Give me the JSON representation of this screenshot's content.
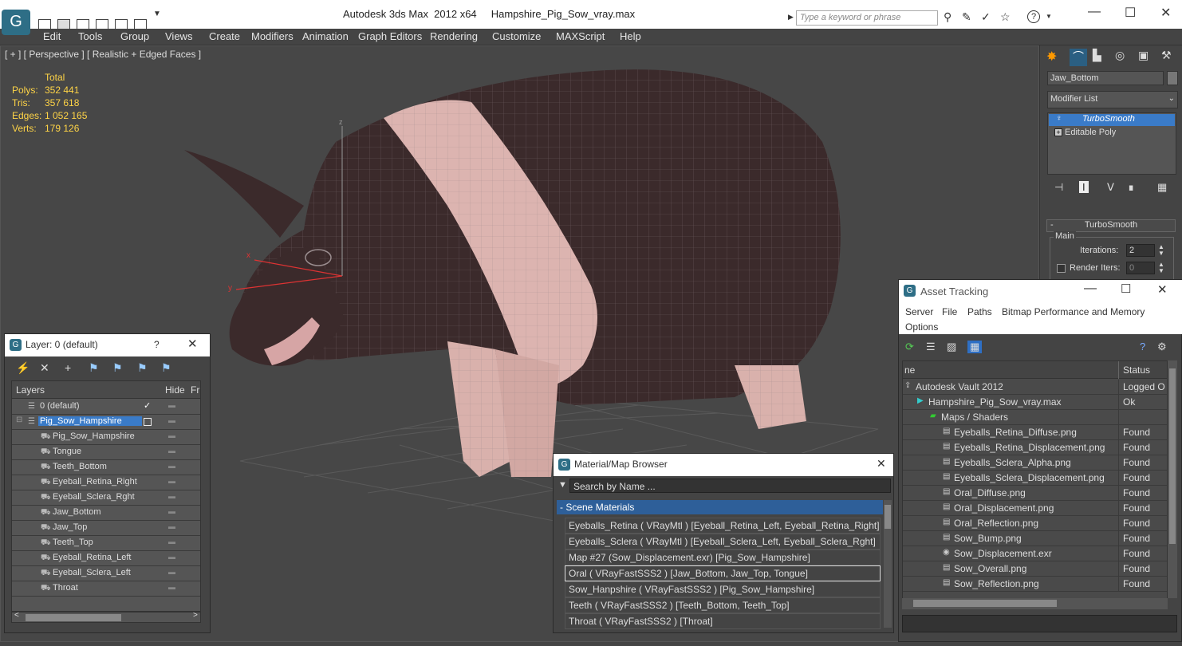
{
  "title": {
    "app": "Autodesk 3ds Max  2012 x64",
    "file": "Hampshire_Pig_Sow_vray.max"
  },
  "search": {
    "placeholder": "Type a keyword or phrase"
  },
  "menu": [
    "Edit",
    "Tools",
    "Group",
    "Views",
    "Create",
    "Modifiers",
    "Animation",
    "Graph Editors",
    "Rendering",
    "Customize",
    "MAXScript",
    "Help"
  ],
  "viewport": {
    "label": "[ + ] [ Perspective ] [ Realistic + Edged Faces ]",
    "stats": {
      "header": "Total",
      "rows": [
        {
          "k": "Polys:",
          "v": "352 441"
        },
        {
          "k": "Tris:",
          "v": "357 618"
        },
        {
          "k": "Edges:",
          "v": "1 052 165"
        },
        {
          "k": "Verts:",
          "v": "179 126"
        }
      ]
    },
    "axes": {
      "x": "x",
      "y": "y",
      "z": "z"
    }
  },
  "command_panel": {
    "object_name": "Jaw_Bottom",
    "modifier_list": "Modifier List",
    "stack": [
      "TurboSmooth",
      "Editable Poly"
    ],
    "rollout_title": "TurboSmooth",
    "group": "Main",
    "iterations_label": "Iterations:",
    "iterations_value": "2",
    "render_iters_label": "Render Iters:",
    "render_iters_value": "0"
  },
  "layer_dialog": {
    "title": "Layer: 0 (default)",
    "help": "?",
    "columns": [
      "Layers",
      "Hide",
      "Fr"
    ],
    "layers": [
      {
        "name": "0 (default)",
        "level": 1,
        "selected": false
      },
      {
        "name": "Pig_Sow_Hampshire",
        "level": 1,
        "selected": true
      },
      {
        "name": "Pig_Sow_Hampshire",
        "level": 2,
        "selected": false
      },
      {
        "name": "Tongue",
        "level": 2,
        "selected": false
      },
      {
        "name": "Teeth_Bottom",
        "level": 2,
        "selected": false
      },
      {
        "name": "Eyeball_Retina_Right",
        "level": 2,
        "selected": false
      },
      {
        "name": "Eyeball_Sclera_Rght",
        "level": 2,
        "selected": false
      },
      {
        "name": "Jaw_Bottom",
        "level": 2,
        "selected": false
      },
      {
        "name": "Jaw_Top",
        "level": 2,
        "selected": false
      },
      {
        "name": "Teeth_Top",
        "level": 2,
        "selected": false
      },
      {
        "name": "Eyeball_Retina_Left",
        "level": 2,
        "selected": false
      },
      {
        "name": "Eyeball_Sclera_Left",
        "level": 2,
        "selected": false
      },
      {
        "name": "Throat",
        "level": 2,
        "selected": false
      }
    ]
  },
  "material_browser": {
    "title": "Material/Map Browser",
    "search_placeholder": "Search by Name ...",
    "group": "- Scene Materials",
    "items": [
      "Eyeballs_Retina  ( VRayMtl ) [Eyeball_Retina_Left, Eyeball_Retina_Right]",
      "Eyeballs_Sclera  ( VRayMtl ) [Eyeball_Sclera_Left, Eyeball_Sclera_Rght]",
      "Map #27 (Sow_Displacement.exr)  [Pig_Sow_Hampshire]",
      "Oral  ( VRayFastSSS2 ) [Jaw_Bottom, Jaw_Top, Tongue]",
      "Sow_Hanpshire  ( VRayFastSSS2 ) [Pig_Sow_Hampshire]",
      "Teeth  ( VRayFastSSS2 ) [Teeth_Bottom, Teeth_Top]",
      "Throat  ( VRayFastSSS2 ) [Throat]"
    ],
    "highlighted_index": 3
  },
  "asset_tracking": {
    "title": "Asset Tracking",
    "menu": [
      "Server",
      "File",
      "Paths",
      "Bitmap Performance and Memory",
      "Options"
    ],
    "columns": [
      "ne",
      "Status"
    ],
    "rows": [
      {
        "name": "Autodesk Vault 2012",
        "status": "Logged O",
        "indent": 0,
        "icon": "vault"
      },
      {
        "name": "Hampshire_Pig_Sow_vray.max",
        "status": "Ok",
        "indent": 1,
        "icon": "max"
      },
      {
        "name": "Maps / Shaders",
        "status": "",
        "indent": 2,
        "icon": "folder"
      },
      {
        "name": "Eyeballs_Retina_Diffuse.png",
        "status": "Found",
        "indent": 3,
        "icon": "png"
      },
      {
        "name": "Eyeballs_Retina_Displacement.png",
        "status": "Found",
        "indent": 3,
        "icon": "png"
      },
      {
        "name": "Eyeballs_Sclera_Alpha.png",
        "status": "Found",
        "indent": 3,
        "icon": "png"
      },
      {
        "name": "Eyeballs_Sclera_Displacement.png",
        "status": "Found",
        "indent": 3,
        "icon": "png"
      },
      {
        "name": "Oral_Diffuse.png",
        "status": "Found",
        "indent": 3,
        "icon": "png"
      },
      {
        "name": "Oral_Displacement.png",
        "status": "Found",
        "indent": 3,
        "icon": "png"
      },
      {
        "name": "Oral_Reflection.png",
        "status": "Found",
        "indent": 3,
        "icon": "png"
      },
      {
        "name": "Sow_Bump.png",
        "status": "Found",
        "indent": 3,
        "icon": "png"
      },
      {
        "name": "Sow_Displacement.exr",
        "status": "Found",
        "indent": 3,
        "icon": "exr"
      },
      {
        "name": "Sow_Overall.png",
        "status": "Found",
        "indent": 3,
        "icon": "png"
      },
      {
        "name": "Sow_Reflection.png",
        "status": "Found",
        "indent": 3,
        "icon": "png"
      }
    ]
  }
}
